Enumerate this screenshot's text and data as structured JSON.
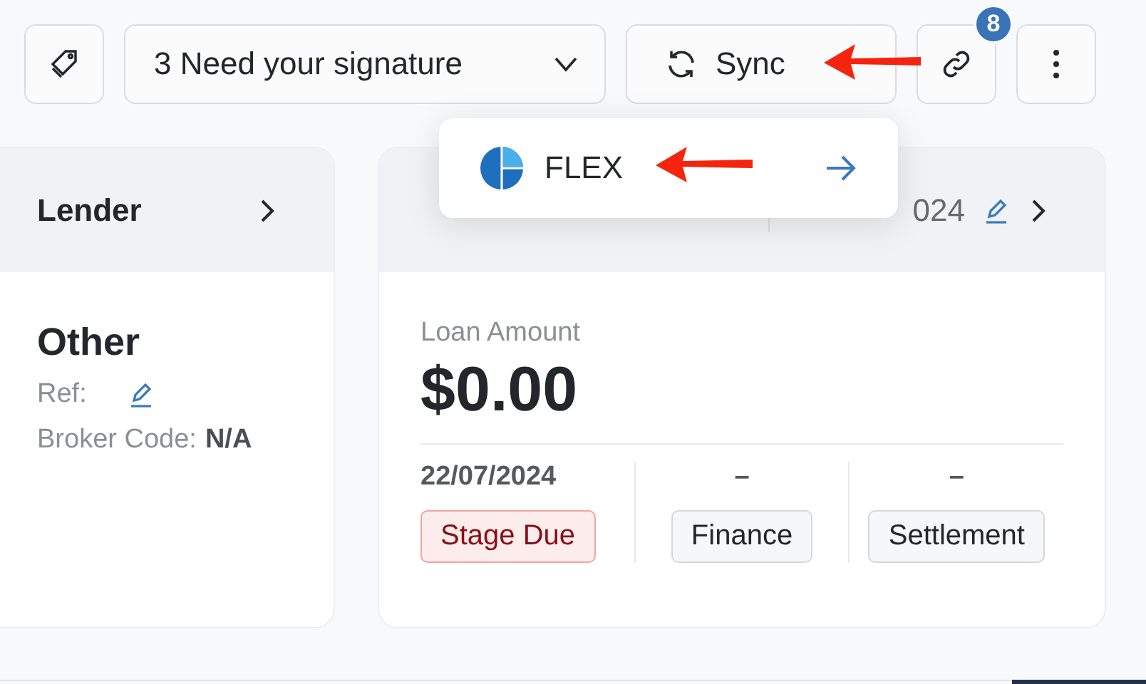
{
  "toolbar": {
    "signature_dropdown": "3 Need your signature",
    "sync_button": "Sync",
    "link_badge": "8"
  },
  "sync_menu": {
    "items": [
      {
        "label": "FLEX"
      }
    ]
  },
  "lender_card": {
    "title": "Lender",
    "name": "Other",
    "ref_label": "Ref:",
    "broker_label": "Broker Code:",
    "broker_value": "N/A"
  },
  "deal_card": {
    "header_date": "024",
    "loan_label": "Loan Amount",
    "loan_amount": "$0.00",
    "stages": [
      {
        "date": "22/07/2024",
        "label": "Stage Due",
        "kind": "due"
      },
      {
        "date": "–",
        "label": "Finance",
        "kind": "plain"
      },
      {
        "date": "–",
        "label": "Settlement",
        "kind": "plain"
      }
    ]
  },
  "annotation_arrows": [
    {
      "kind": "pointer"
    },
    {
      "kind": "pointer"
    }
  ]
}
